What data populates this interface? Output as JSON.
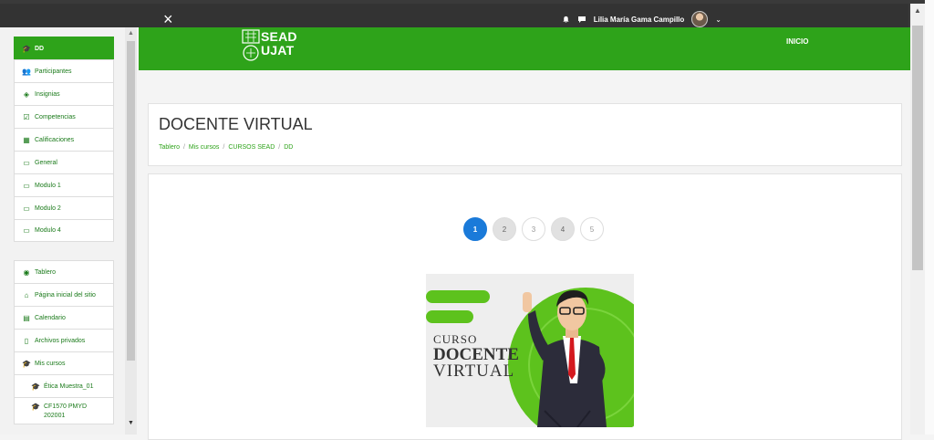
{
  "topbar": {
    "close_icon": "×",
    "user_name": "Lilia María Gama Campillo"
  },
  "header": {
    "logo_line1": "SEAD",
    "logo_line2": "UJAT",
    "nav_inicio": "INICIO"
  },
  "sidebar": {
    "course_items": [
      {
        "label": "DD",
        "icon": "graduation-cap-icon"
      },
      {
        "label": "Participantes",
        "icon": "users-icon"
      },
      {
        "label": "Insignias",
        "icon": "shield-icon"
      },
      {
        "label": "Competencias",
        "icon": "check-square-icon"
      },
      {
        "label": "Calificaciones",
        "icon": "table-icon"
      },
      {
        "label": "General",
        "icon": "folder-icon"
      },
      {
        "label": "Modulo 1",
        "icon": "folder-icon"
      },
      {
        "label": "Modulo 2",
        "icon": "folder-icon"
      },
      {
        "label": "Modulo 4",
        "icon": "folder-icon"
      }
    ],
    "site_items": [
      {
        "label": "Tablero",
        "icon": "dashboard-icon"
      },
      {
        "label": "Página inicial del sitio",
        "icon": "home-icon"
      },
      {
        "label": "Calendario",
        "icon": "calendar-icon"
      },
      {
        "label": "Archivos privados",
        "icon": "file-icon"
      },
      {
        "label": "Mis cursos",
        "icon": "graduation-cap-icon"
      },
      {
        "label": "Ética Muestra_01",
        "icon": "graduation-cap-icon"
      },
      {
        "label": "CF1570 PMYD 202001",
        "icon": "graduation-cap-icon"
      }
    ]
  },
  "main": {
    "page_title": "DOCENTE VIRTUAL",
    "breadcrumb": [
      "Tablero",
      "Mis cursos",
      "CURSOS SEAD",
      "DD"
    ],
    "pagination": [
      "1",
      "2",
      "3",
      "4",
      "5"
    ],
    "banner": {
      "line1": "CURSO",
      "line2": "DOCENTE",
      "line3": "VIRTUAL"
    }
  },
  "colors": {
    "brand_green": "#2ea31a",
    "topbar_dark": "#333333",
    "page_active_blue": "#1a7ad9"
  }
}
